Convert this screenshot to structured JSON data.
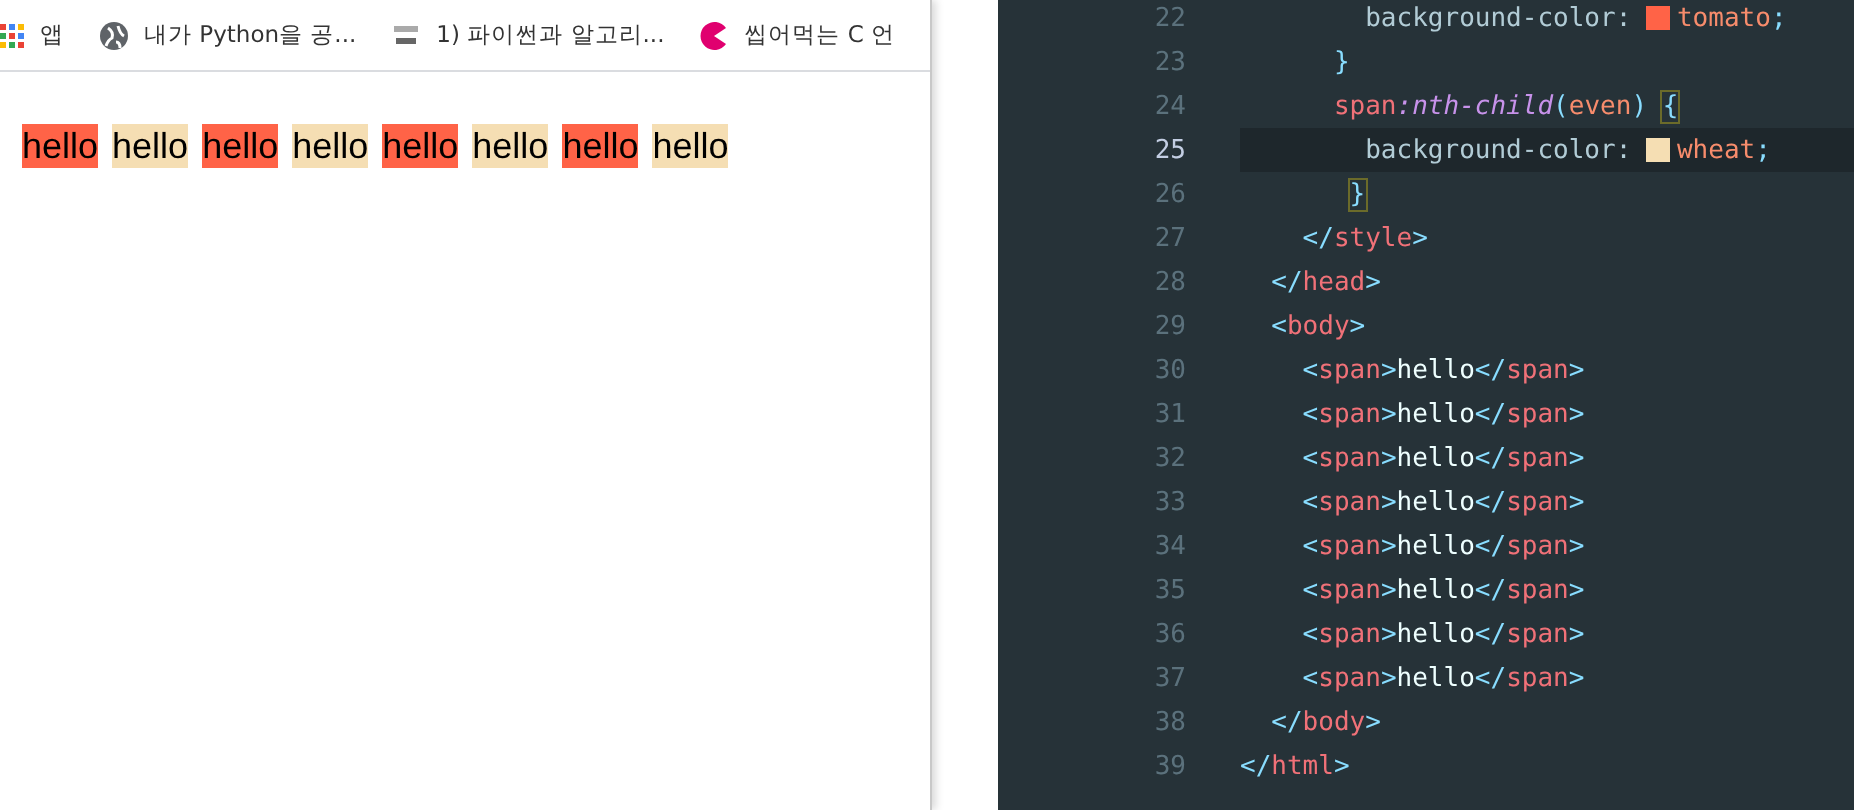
{
  "bookmarks": [
    {
      "kind": "apps",
      "label": "앱"
    },
    {
      "kind": "globe",
      "label": "내가 Python을 공..."
    },
    {
      "kind": "wikidocs",
      "label": "1) 파이썬과 알고리..."
    },
    {
      "kind": "pacman",
      "label": "씹어먹는 C 언"
    }
  ],
  "page_spans": [
    {
      "text": "hello",
      "color": "#ff6347"
    },
    {
      "text": "hello",
      "color": "#f5deb3"
    },
    {
      "text": "hello",
      "color": "#ff6347"
    },
    {
      "text": "hello",
      "color": "#f5deb3"
    },
    {
      "text": "hello",
      "color": "#ff6347"
    },
    {
      "text": "hello",
      "color": "#f5deb3"
    },
    {
      "text": "hello",
      "color": "#ff6347"
    },
    {
      "text": "hello",
      "color": "#f5deb3"
    }
  ],
  "editor": {
    "lines": [
      {
        "children": [
          {
            "children": [
              {
                "children": [
                  {
                    "children": [
                      {
                        "number": "22",
                        "current": false,
                        "tokens": [
                          {
                            "kind": "property",
                            "text": "background-color:"
                          },
                          {
                            "kind": "swatch",
                            "color": "#ff6347"
                          },
                          {
                            "kind": "value",
                            "text": "tomato"
                          },
                          {
                            "kind": "punct",
                            "text": ";"
                          }
                        ]
                      }
                    ]
                  },
                  {
                    "number": "23",
                    "current": false,
                    "tokens": [
                      {
                        "kind": "punct",
                        "text": "}"
                      }
                    ]
                  },
                  {
                    "number": "24",
                    "current": false,
                    "tokens": [
                      {
                        "kind": "selector",
                        "text": "span"
                      },
                      {
                        "kind": "pseudo",
                        "text": ":nth-child"
                      },
                      {
                        "kind": "punct",
                        "text": "("
                      },
                      {
                        "kind": "value",
                        "text": "even"
                      },
                      {
                        "kind": "punct",
                        "text": ")"
                      },
                      {
                        "kind": "match",
                        "text": "{"
                      }
                    ],
                    "children": [
                      {
                        "number": "25",
                        "current": true,
                        "tokens": [
                          {
                            "kind": "property",
                            "text": "background-color:"
                          },
                          {
                            "kind": "swatch",
                            "color": "#f5deb3"
                          },
                          {
                            "kind": "value",
                            "text": "wheat"
                          },
                          {
                            "kind": "punct",
                            "text": ";"
                          }
                        ]
                      }
                    ]
                  },
                  {
                    "number": "26",
                    "current": false,
                    "tokens": [
                      {
                        "kind": "match",
                        "text": "}"
                      }
                    ]
                  }
                ]
              },
              {
                "number": "27",
                "current": false,
                "tokens": [
                  {
                    "kind": "bracket",
                    "text": "</"
                  },
                  {
                    "kind": "tag",
                    "text": "style"
                  },
                  {
                    "kind": "bracket",
                    "text": ">"
                  }
                ]
              }
            ]
          },
          {
            "number": "28",
            "current": false,
            "tokens": [
              {
                "kind": "bracket",
                "text": "</"
              },
              {
                "kind": "tag",
                "text": "head"
              },
              {
                "kind": "bracket",
                "text": ">"
              }
            ]
          },
          {
            "number": "29",
            "current": false,
            "tokens": [
              {
                "kind": "bracket",
                "text": "<"
              },
              {
                "kind": "tag",
                "text": "body"
              },
              {
                "kind": "bracket",
                "text": ">"
              }
            ],
            "children": [
              {
                "number": "30",
                "current": false,
                "tokens": [
                  {
                    "kind": "bracket",
                    "text": "<"
                  },
                  {
                    "kind": "tag",
                    "text": "span"
                  },
                  {
                    "kind": "bracket",
                    "text": ">"
                  },
                  {
                    "kind": "text",
                    "text": "hello"
                  },
                  {
                    "kind": "bracket",
                    "text": "</"
                  },
                  {
                    "kind": "tag",
                    "text": "span"
                  },
                  {
                    "kind": "bracket",
                    "text": ">"
                  }
                ]
              },
              {
                "number": "31",
                "current": false,
                "tokens": [
                  {
                    "kind": "bracket",
                    "text": "<"
                  },
                  {
                    "kind": "tag",
                    "text": "span"
                  },
                  {
                    "kind": "bracket",
                    "text": ">"
                  },
                  {
                    "kind": "text",
                    "text": "hello"
                  },
                  {
                    "kind": "bracket",
                    "text": "</"
                  },
                  {
                    "kind": "tag",
                    "text": "span"
                  },
                  {
                    "kind": "bracket",
                    "text": ">"
                  }
                ]
              },
              {
                "number": "32",
                "current": false,
                "tokens": [
                  {
                    "kind": "bracket",
                    "text": "<"
                  },
                  {
                    "kind": "tag",
                    "text": "span"
                  },
                  {
                    "kind": "bracket",
                    "text": ">"
                  },
                  {
                    "kind": "text",
                    "text": "hello"
                  },
                  {
                    "kind": "bracket",
                    "text": "</"
                  },
                  {
                    "kind": "tag",
                    "text": "span"
                  },
                  {
                    "kind": "bracket",
                    "text": ">"
                  }
                ]
              },
              {
                "number": "33",
                "current": false,
                "tokens": [
                  {
                    "kind": "bracket",
                    "text": "<"
                  },
                  {
                    "kind": "tag",
                    "text": "span"
                  },
                  {
                    "kind": "bracket",
                    "text": ">"
                  },
                  {
                    "kind": "text",
                    "text": "hello"
                  },
                  {
                    "kind": "bracket",
                    "text": "</"
                  },
                  {
                    "kind": "tag",
                    "text": "span"
                  },
                  {
                    "kind": "bracket",
                    "text": ">"
                  }
                ]
              },
              {
                "number": "34",
                "current": false,
                "tokens": [
                  {
                    "kind": "bracket",
                    "text": "<"
                  },
                  {
                    "kind": "tag",
                    "text": "span"
                  },
                  {
                    "kind": "bracket",
                    "text": ">"
                  },
                  {
                    "kind": "text",
                    "text": "hello"
                  },
                  {
                    "kind": "bracket",
                    "text": "</"
                  },
                  {
                    "kind": "tag",
                    "text": "span"
                  },
                  {
                    "kind": "bracket",
                    "text": ">"
                  }
                ]
              },
              {
                "number": "35",
                "current": false,
                "tokens": [
                  {
                    "kind": "bracket",
                    "text": "<"
                  },
                  {
                    "kind": "tag",
                    "text": "span"
                  },
                  {
                    "kind": "bracket",
                    "text": ">"
                  },
                  {
                    "kind": "text",
                    "text": "hello"
                  },
                  {
                    "kind": "bracket",
                    "text": "</"
                  },
                  {
                    "kind": "tag",
                    "text": "span"
                  },
                  {
                    "kind": "bracket",
                    "text": ">"
                  }
                ]
              },
              {
                "number": "36",
                "current": false,
                "tokens": [
                  {
                    "kind": "bracket",
                    "text": "<"
                  },
                  {
                    "kind": "tag",
                    "text": "span"
                  },
                  {
                    "kind": "bracket",
                    "text": ">"
                  },
                  {
                    "kind": "text",
                    "text": "hello"
                  },
                  {
                    "kind": "bracket",
                    "text": "</"
                  },
                  {
                    "kind": "tag",
                    "text": "span"
                  },
                  {
                    "kind": "bracket",
                    "text": ">"
                  }
                ]
              },
              {
                "number": "37",
                "current": false,
                "tokens": [
                  {
                    "kind": "bracket",
                    "text": "<"
                  },
                  {
                    "kind": "tag",
                    "text": "span"
                  },
                  {
                    "kind": "bracket",
                    "text": ">"
                  },
                  {
                    "kind": "text",
                    "text": "hello"
                  },
                  {
                    "kind": "bracket",
                    "text": "</"
                  },
                  {
                    "kind": "tag",
                    "text": "span"
                  },
                  {
                    "kind": "bracket",
                    "text": ">"
                  }
                ]
              }
            ]
          },
          {
            "number": "38",
            "current": false,
            "tokens": [
              {
                "kind": "bracket",
                "text": "</"
              },
              {
                "kind": "tag",
                "text": "body"
              },
              {
                "kind": "bracket",
                "text": ">"
              }
            ]
          }
        ]
      },
      {
        "number": "39",
        "current": false,
        "tokens": [
          {
            "kind": "bracket",
            "text": "</"
          },
          {
            "kind": "tag",
            "text": "html"
          },
          {
            "kind": "bracket",
            "text": ">"
          }
        ]
      }
    ]
  }
}
